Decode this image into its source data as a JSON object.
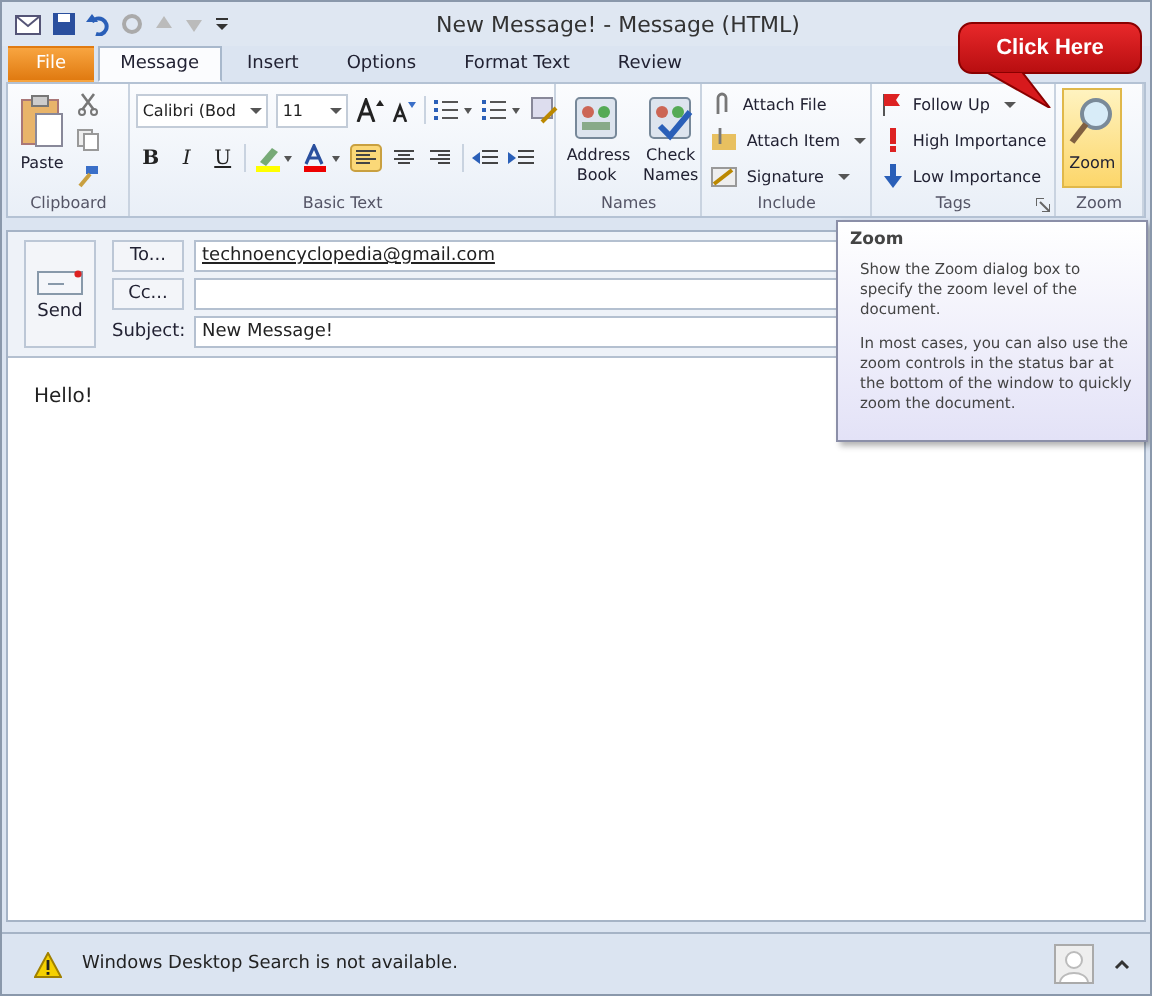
{
  "window": {
    "title": "New Message! - Message (HTML)"
  },
  "tabs": [
    {
      "label": "File",
      "kind": "file",
      "selected": false
    },
    {
      "label": "Message",
      "kind": "tab",
      "selected": true
    },
    {
      "label": "Insert",
      "kind": "tab",
      "selected": false
    },
    {
      "label": "Options",
      "kind": "tab",
      "selected": false
    },
    {
      "label": "Format Text",
      "kind": "tab",
      "selected": false
    },
    {
      "label": "Review",
      "kind": "tab",
      "selected": false
    }
  ],
  "ribbon": {
    "clipboard": {
      "label": "Clipboard",
      "paste": "Paste"
    },
    "basic_text": {
      "label": "Basic Text",
      "font": "Calibri (Bod",
      "size": "11",
      "format_buttons": [
        "B",
        "I",
        "U"
      ]
    },
    "names": {
      "label": "Names",
      "buttons": [
        "Address Book",
        "Check Names"
      ]
    },
    "include": {
      "label": "Include",
      "buttons": [
        {
          "label": "Attach File",
          "dropdown": false
        },
        {
          "label": "Attach Item",
          "dropdown": true
        },
        {
          "label": "Signature",
          "dropdown": true
        }
      ]
    },
    "tags": {
      "label": "Tags",
      "buttons": [
        {
          "label": "Follow Up",
          "dropdown": true
        },
        {
          "label": "High Importance",
          "dropdown": false
        },
        {
          "label": "Low Importance",
          "dropdown": false
        }
      ]
    },
    "zoom": {
      "label": "Zoom",
      "button": "Zoom",
      "highlighted": true
    }
  },
  "compose": {
    "send": "Send",
    "to_button": "To...",
    "to": "technoencyclopedia@gmail.com",
    "cc_button": "Cc...",
    "subject_label": "Subject:",
    "subject": "New Message!",
    "body": "Hello!"
  },
  "tooltip": {
    "title": "Zoom",
    "paragraphs": [
      "Show the Zoom dialog box to specify the zoom level of the document.",
      "In most cases, you can also use the zoom controls in the status bar at the bottom of the window to quickly zoom the document."
    ]
  },
  "callout": {
    "text": "Click Here"
  },
  "status_bar": {
    "message": "Windows Desktop Search is not available."
  }
}
